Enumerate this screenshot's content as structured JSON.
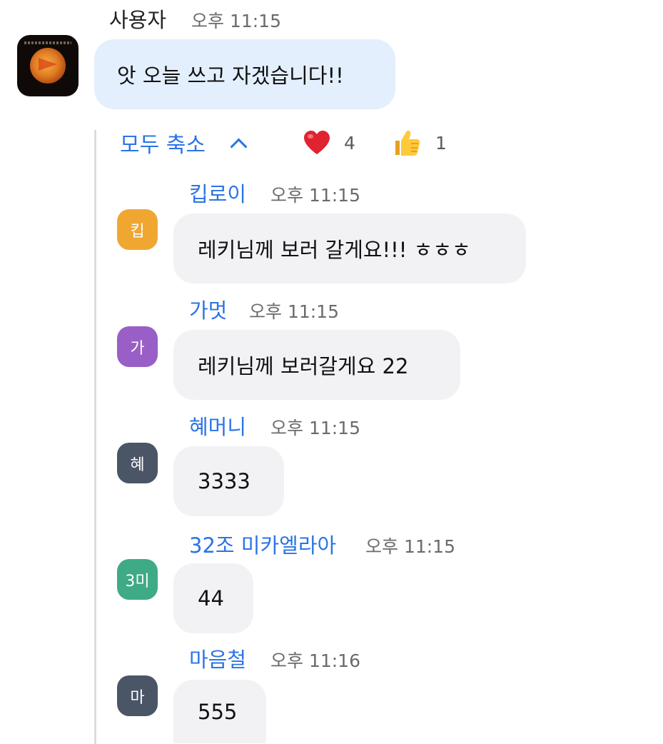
{
  "parent": {
    "sender": "사용자",
    "time": "오후 11:15",
    "text": "앗 오늘 쓰고 자겠습니다!!"
  },
  "thread": {
    "collapse_label": "모두 축소",
    "reactions": [
      {
        "icon": "heart-icon",
        "count": "4"
      },
      {
        "icon": "thumbs-up-icon",
        "count": "1"
      }
    ]
  },
  "replies": [
    {
      "avatar_text": "킵",
      "avatar_color": "#f0a732",
      "name": "킵로이",
      "time": "오후 11:15",
      "text": "레키님께 보러 갈게요!!! ㅎㅎㅎ"
    },
    {
      "avatar_text": "가",
      "avatar_color": "#9a5fc6",
      "name": "가멋",
      "time": "오후 11:15",
      "text": "레키님께 보러갈게요 22"
    },
    {
      "avatar_text": "혜",
      "avatar_color": "#4a5566",
      "name": "혜머니",
      "time": "오후 11:15",
      "text": "3333"
    },
    {
      "avatar_text": "3미",
      "avatar_color": "#3faa86",
      "name": "32조 미카엘라아",
      "time": "오후 11:15",
      "text": "44"
    },
    {
      "avatar_text": "마",
      "avatar_color": "#4a5566",
      "name": "마음철",
      "time": "오후 11:16",
      "text": "555"
    }
  ],
  "colors": {
    "accent": "#2b74e5",
    "parent_bubble": "#e3effd",
    "reply_bubble": "#f2f2f5"
  }
}
